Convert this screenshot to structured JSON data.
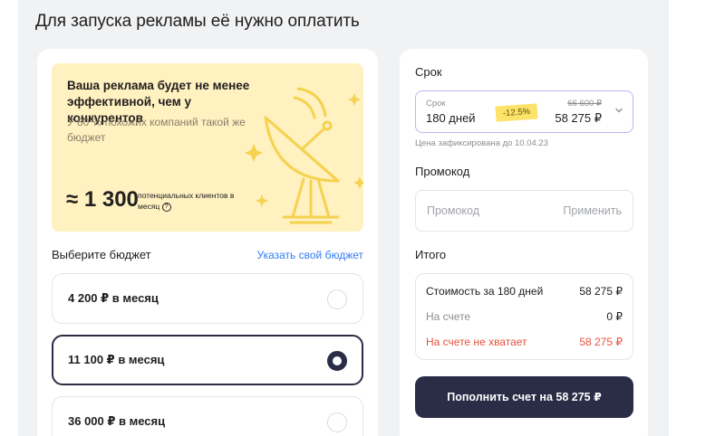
{
  "page": {
    "title": "Для запуска рекламы её нужно оплатить"
  },
  "promo": {
    "title": "Ваша реклама будет не менее эффективной, чем у конкурентов",
    "subtitle": "У 80 % похожих компаний такой же бюджет",
    "clients_value": "≈ 1 300",
    "clients_caption": "потенциальных клиентов в месяц",
    "info_icon": "question-circle-icon",
    "illustration": "satellite-dish-icon",
    "accent_color": "#f5d24f"
  },
  "budget": {
    "heading": "Выберите бюджет",
    "custom_link": "Указать свой бюджет",
    "options": [
      {
        "label": "4 200 ₽ в месяц",
        "selected": false
      },
      {
        "label": "11 100 ₽ в месяц",
        "selected": true
      },
      {
        "label": "36 000 ₽ в месяц",
        "selected": false
      }
    ]
  },
  "term": {
    "heading": "Срок",
    "select_caption": "Срок",
    "select_value": "180 дней",
    "discount_badge": "-12.5%",
    "old_price": "66 600 ₽",
    "price": "58 275 ₽",
    "fixed_note": "Цена зафиксирована до 10.04.23",
    "chevron_icon": "chevron-down-icon"
  },
  "promocode": {
    "heading": "Промокод",
    "placeholder": "Промокод",
    "apply_label": "Применить"
  },
  "total": {
    "heading": "Итого",
    "rows": [
      {
        "label": "Стоимость за 180 дней",
        "value": "58 275 ₽"
      },
      {
        "label": "На счете",
        "value": "0 ₽"
      },
      {
        "label": "На счете не хватает",
        "value": "58 275 ₽"
      }
    ],
    "pay_button": "Пополнить счет на 58 275 ₽"
  },
  "colors": {
    "primary_dark": "#2a2d45",
    "link_blue": "#2e7df6",
    "warning_red": "#e8513e",
    "promo_bg": "#fff1c0",
    "badge_yellow": "#fde36a"
  }
}
